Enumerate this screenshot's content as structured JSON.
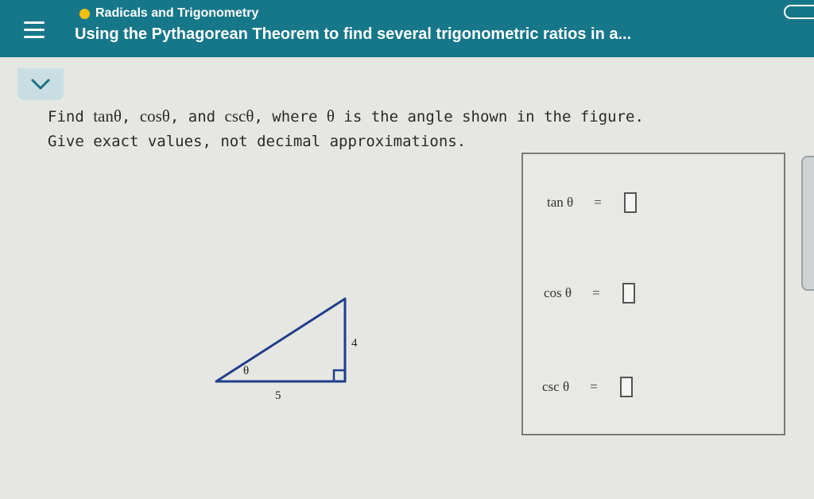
{
  "header": {
    "topic": "Radicals and Trigonometry",
    "lesson": "Using the Pythagorean Theorem to find several trigonometric ratios in a...",
    "colors": {
      "bar": "#17778a",
      "topic_dot": "#f3c012"
    }
  },
  "question": {
    "line1": {
      "find": "Find ",
      "tan": "tanθ",
      "sep1": ", ",
      "cos": "cosθ",
      "sep2": ", and ",
      "csc": "cscθ",
      "where": ", where ",
      "theta": "θ",
      "rest": " is the angle shown in the figure."
    },
    "line2": "Give exact values, not decimal approximations."
  },
  "figure": {
    "side_vertical": "4",
    "side_horizontal": "5",
    "angle_label": "θ",
    "line_color": "#1f3e8c"
  },
  "answers": [
    {
      "label": "tan θ",
      "equals": "=",
      "value": ""
    },
    {
      "label": "cos θ",
      "equals": "=",
      "value": ""
    },
    {
      "label": "csc θ",
      "equals": "=",
      "value": ""
    }
  ]
}
